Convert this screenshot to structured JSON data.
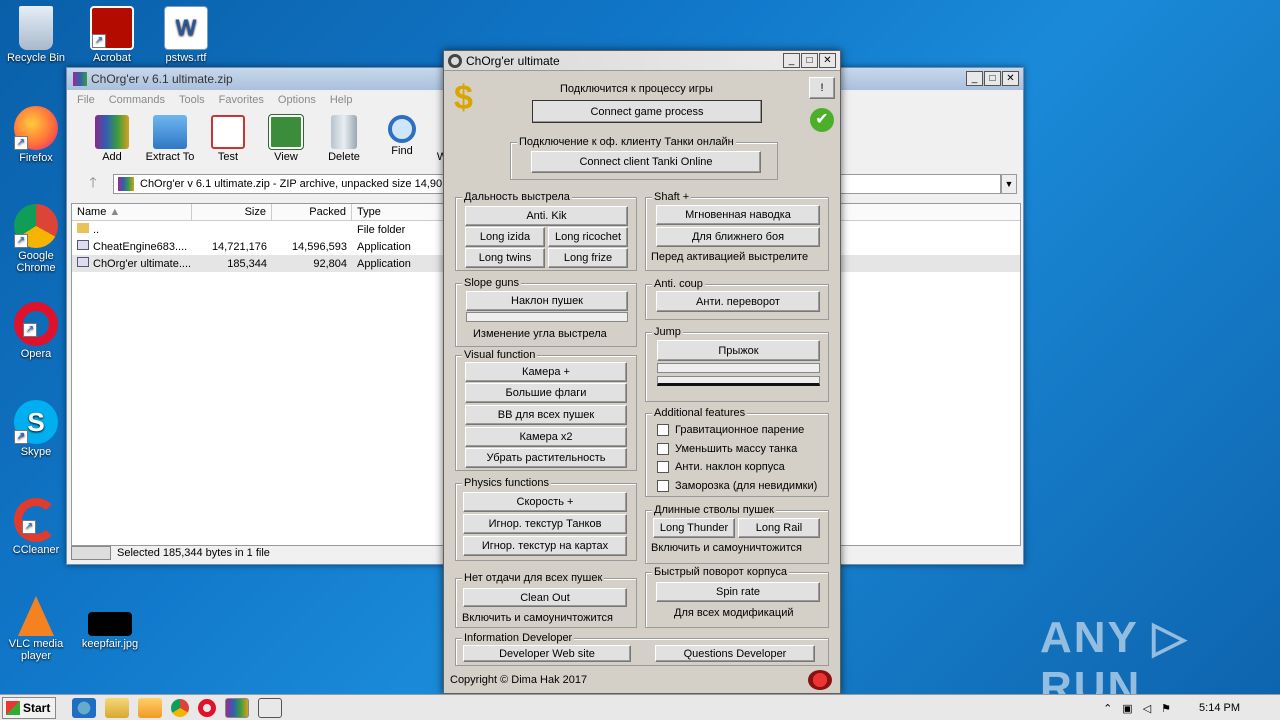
{
  "desktop": {
    "icons": [
      {
        "label": "Recycle Bin"
      },
      {
        "label": "Acrobat"
      },
      {
        "label": "pstws.rtf"
      },
      {
        "label": "Firefox"
      },
      {
        "label": "Google Chrome"
      },
      {
        "label": "Opera"
      },
      {
        "label": "Skype"
      },
      {
        "label": "CCleaner"
      },
      {
        "label": "VLC media player"
      },
      {
        "label": "keepfair.jpg"
      }
    ],
    "watermark": "ANY ▷ RUN"
  },
  "winrar": {
    "title": "ChOrg'er v 6.1 ultimate.zip",
    "menu": [
      "File",
      "Commands",
      "Tools",
      "Favorites",
      "Options",
      "Help"
    ],
    "toolbar": [
      "Add",
      "Extract To",
      "Test",
      "View",
      "Delete",
      "Find",
      "Wiz"
    ],
    "address": "ChOrg'er v 6.1 ultimate.zip - ZIP archive, unpacked size 14,90",
    "columns": [
      "Name",
      "Size",
      "Packed",
      "Type"
    ],
    "rows": [
      {
        "name": "..",
        "size": "",
        "packed": "",
        "type": "File folder"
      },
      {
        "name": "CheatEngine683....",
        "size": "14,721,176",
        "packed": "14,596,593",
        "type": "Application"
      },
      {
        "name": "ChOrg'er ultimate....",
        "size": "185,344",
        "packed": "92,804",
        "type": "Application"
      }
    ],
    "status": "Selected 185,344 bytes in 1 file"
  },
  "app": {
    "title": "ChOrg'er ultimate",
    "connect_process_label": "Подключится к процессу игры",
    "connect_process_btn": "Connect game process",
    "help_btn": "!",
    "client_group": "Подключение к оф. клиенту Танки онлайн",
    "connect_client_btn": "Connect client Tanki Online",
    "range_group": "Дальность выстрела",
    "anti_kik": "Anti. Kik",
    "long_izida": "Long izida",
    "long_ricochet": "Long ricochet",
    "long_twins": "Long twins",
    "long_frize": "Long frize",
    "shaft_group": "Shaft +",
    "instant_aim": "Мгновенная наводка",
    "close_combat": "Для ближнего боя",
    "shaft_note": "Перед активацией выстрелите",
    "slope_group": "Slope guns",
    "tilt_guns": "Наклон пушек",
    "slope_note": "Изменение угла выстрела",
    "anticoup_group": "Anti. coup",
    "anti_flip": "Анти. переворот",
    "visual_group": "Visual function",
    "camera_plus": "Камера +",
    "big_flags": "Большие флаги",
    "bb_all": "ВВ для всех пушек",
    "camera_x2": "Камера х2",
    "remove_plants": "Убрать растительность",
    "jump_group": "Jump",
    "jump_btn": "Прыжок",
    "additional_group": "Additional features",
    "checks": [
      "Гравитационное парение",
      "Уменьшить массу танка",
      "Анти. наклон корпуса",
      "Заморозка (для невидимки)"
    ],
    "physics_group": "Physics functions",
    "speed_plus": "Скорость +",
    "ignore_tank_tex": "Игнор. текстур Танков",
    "ignore_map_tex": "Игнор. текстур на картах",
    "long_barrels_group": "Длинные стволы пушек",
    "long_thunder": "Long Thunder",
    "long_rail": "Long Rail",
    "long_barrels_note": "Включить и самоуничтожится",
    "recoil_group": "Нет отдачи для всех пушек",
    "clean_out": "Clean Out",
    "recoil_note": "Включить и самоуничтожится",
    "turn_group": "Быстрый поворот корпуса",
    "spin_rate": "Spin rate",
    "turn_note": "Для всех модификаций",
    "info_group": "Information Developer",
    "dev_site": "Developer Web site",
    "questions": "Questions Developer",
    "copyright": "Copyright © Dima Hak 2017"
  },
  "taskbar": {
    "start": "Start",
    "clock": "5:14 PM"
  }
}
